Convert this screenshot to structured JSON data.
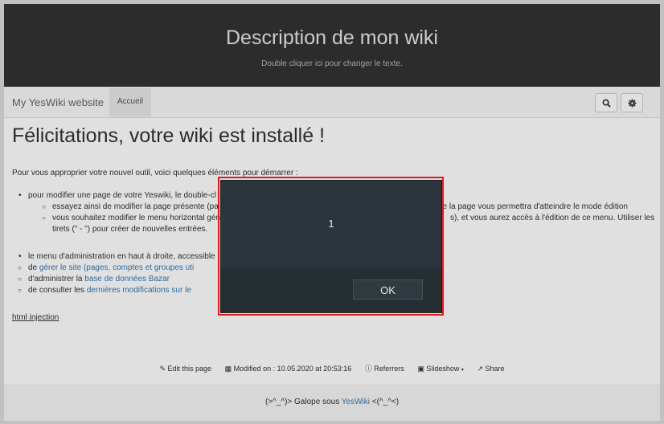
{
  "header": {
    "title": "Description de mon wiki",
    "subtitle": "Double cliquer ici pour changer le texte."
  },
  "nav": {
    "brand": "My YesWiki website",
    "tab": "Accueil"
  },
  "page": {
    "heading": "Félicitations, votre wiki est installé !",
    "intro": "Pour vous approprier votre nouvel outil, voici quelques éléments pour démarrer :",
    "item1": "pour modifier une page de votre Yeswiki, le double-cl",
    "item1_sub1_a": "essayez ainsi de modifier la page présente (pa",
    "item1_sub1_b": "de la page vous permettra d'atteindre le mode édition",
    "item1_sub2_a": "vous souhaitez modifier le menu horizontal gén",
    "item1_sub2_b": "s), et vous aurez accès à l'édition de ce menu. Utiliser les",
    "item1_sub2_c": "tirets (\" - \") pour créer de nouvelles entrées.",
    "item2": "le menu d'administration en haut à droite, accessible",
    "item2_sub1_pre": "de ",
    "item2_sub1_link": "gérer le site (pages, comptes et groupes uti",
    "item2_sub2_pre": "d'administrer la ",
    "item2_sub2_link": "base de données Bazar",
    "item2_sub3_pre": "de consulter les ",
    "item2_sub3_link": "dernières modifications sur le",
    "injection": "html injection"
  },
  "footer": {
    "edit": "Edit this page",
    "modified": "Modified on : 10.05.2020 at 20:53:16",
    "referrers": "Referrers",
    "slideshow": "Slideshow",
    "share": "Share",
    "credit_pre": "(>^_^)> Galope sous ",
    "credit_link": "YesWiki",
    "credit_post": " <(^_^<)"
  },
  "dialog": {
    "message": "1",
    "ok_label": "OK"
  },
  "colors": {
    "link": "#337ab7",
    "dialog_bg": "#2b353b",
    "highlight": "#e0191e"
  },
  "icons": [
    "search-icon",
    "gear-icon",
    "pencil-icon",
    "calendar-icon",
    "info-icon",
    "film-icon",
    "share-icon"
  ]
}
